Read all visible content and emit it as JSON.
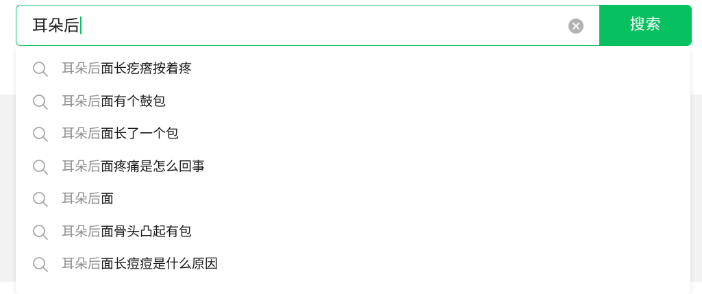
{
  "search": {
    "query": "耳朵后",
    "button_label": "搜索"
  },
  "suggestions": [
    {
      "prefix": "耳朵后",
      "rest": "面长疙瘩按着疼"
    },
    {
      "prefix": "耳朵后",
      "rest": "面有个鼓包"
    },
    {
      "prefix": "耳朵后",
      "rest": "面长了一个包"
    },
    {
      "prefix": "耳朵后",
      "rest": "面疼痛是怎么回事"
    },
    {
      "prefix": "耳朵后",
      "rest": "面"
    },
    {
      "prefix": "耳朵后",
      "rest": "面骨头凸起有包"
    },
    {
      "prefix": "耳朵后",
      "rest": "面长痘痘是什么原因"
    }
  ],
  "colors": {
    "accent": "#07c160",
    "muted_text": "#8c8c8c",
    "clear_icon_bg": "#b2b2b2"
  },
  "icons": {
    "suggestion": "search-icon",
    "clear": "clear-icon"
  }
}
